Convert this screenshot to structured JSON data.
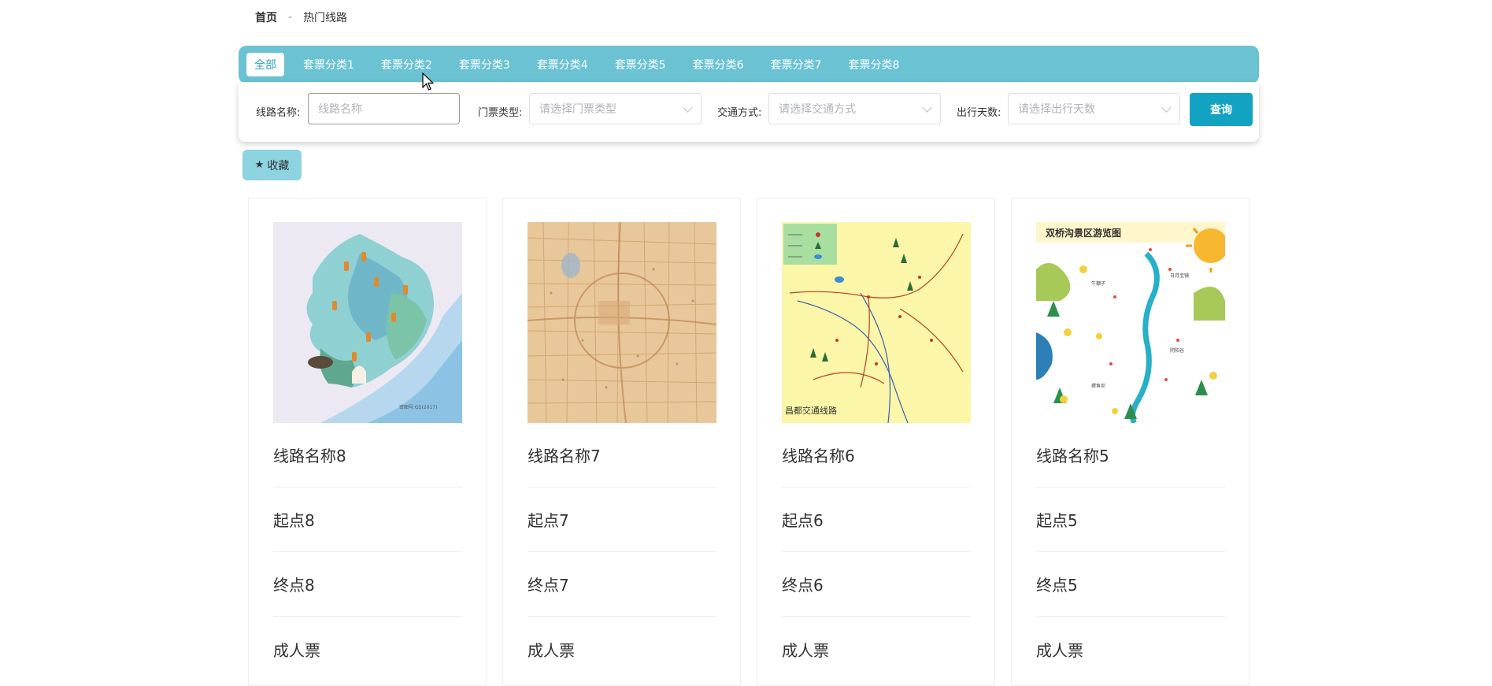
{
  "breadcrumb": {
    "home": "首页",
    "separator": "-",
    "current": "热门线路"
  },
  "categories": [
    {
      "label": "全部",
      "active": true
    },
    {
      "label": "套票分类1"
    },
    {
      "label": "套票分类2"
    },
    {
      "label": "套票分类3"
    },
    {
      "label": "套票分类4"
    },
    {
      "label": "套票分类5"
    },
    {
      "label": "套票分类6"
    },
    {
      "label": "套票分类7"
    },
    {
      "label": "套票分类8"
    }
  ],
  "search": {
    "route_name_label": "线路名称:",
    "route_name_placeholder": "线路名称",
    "ticket_type_label": "门票类型:",
    "ticket_type_placeholder": "请选择门票类型",
    "transport_label": "交通方式:",
    "transport_placeholder": "请选择交通方式",
    "days_label": "出行天数:",
    "days_placeholder": "请选择出行天数",
    "query_label": "查询"
  },
  "favorites": {
    "icon": "star-icon",
    "label": "收藏"
  },
  "cards": [
    {
      "name": "线路名称8",
      "start": "起点8",
      "end": "终点8",
      "ticket": "成人票",
      "image": "province-map"
    },
    {
      "name": "线路名称7",
      "start": "起点7",
      "end": "终点7",
      "ticket": "成人票",
      "image": "city-map"
    },
    {
      "name": "线路名称6",
      "start": "起点6",
      "end": "终点6",
      "ticket": "成人票",
      "image": "drawn-route-map"
    },
    {
      "name": "线路名称5",
      "start": "起点5",
      "end": "终点5",
      "ticket": "成人票",
      "image": "scenic-guide-map"
    }
  ],
  "colors": {
    "accent": "#6ac2d3",
    "button": "#12a3c3",
    "favorite": "#8dd3e0",
    "active_tab_text": "#29a3bd"
  }
}
